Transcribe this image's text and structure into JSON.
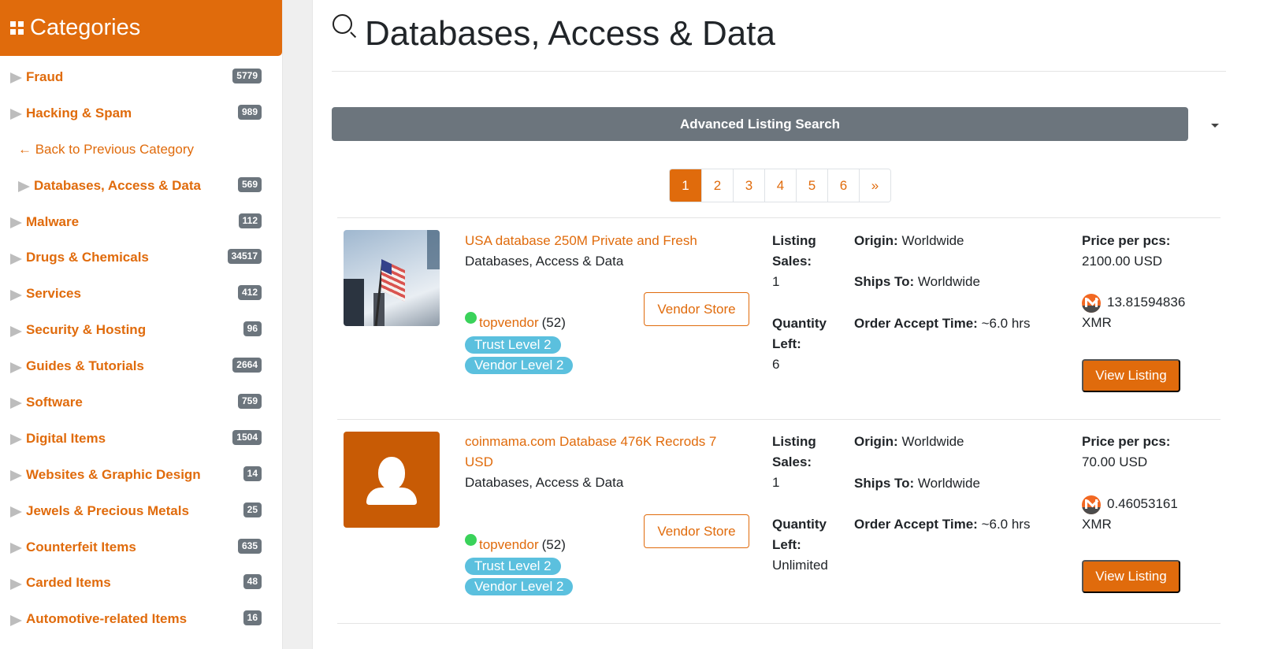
{
  "sidebar": {
    "header": "Categories",
    "back_label": "← Back to Previous Category",
    "categories": [
      {
        "label": "Fraud",
        "count": "5779"
      },
      {
        "label": "Hacking & Spam",
        "count": "989"
      },
      {
        "label": "Databases, Access & Data",
        "count": "569"
      },
      {
        "label": "Malware",
        "count": "112"
      },
      {
        "label": "Drugs & Chemicals",
        "count": "34517"
      },
      {
        "label": "Services",
        "count": "412"
      },
      {
        "label": "Security & Hosting",
        "count": "96"
      },
      {
        "label": "Guides & Tutorials",
        "count": "2664"
      },
      {
        "label": "Software",
        "count": "759"
      },
      {
        "label": "Digital Items",
        "count": "1504"
      },
      {
        "label": "Websites & Graphic Design",
        "count": "14"
      },
      {
        "label": "Jewels & Precious Metals",
        "count": "25"
      },
      {
        "label": "Counterfeit Items",
        "count": "635"
      },
      {
        "label": "Carded Items",
        "count": "48"
      },
      {
        "label": "Automotive-related Items",
        "count": "16"
      }
    ]
  },
  "main": {
    "title": "Databases, Access & Data",
    "advanced_search_label": "Advanced Listing Search",
    "pagination": {
      "pages": [
        "1",
        "2",
        "3",
        "4",
        "5",
        "6"
      ],
      "next": "»",
      "current": "1"
    },
    "labels": {
      "listing_sales": "Listing Sales:",
      "quantity_left": "Quantity Left:",
      "origin": "Origin:",
      "ships_to": "Ships To:",
      "order_accept_time": "Order Accept Time:",
      "price_per_pcs": "Price per pcs:",
      "vendor_store": "Vendor Store",
      "view_listing": "View Listing",
      "xmr": "XMR"
    },
    "listings": [
      {
        "title": "USA database 250M Private and Fresh",
        "category": "Databases, Access & Data",
        "vendor": "topvendor",
        "vendor_count": "(52)",
        "trust_level": "Trust Level 2",
        "vendor_level": "Vendor Level 2",
        "sales": "1",
        "quantity_left": "6",
        "origin": "Worldwide",
        "ships_to": "Worldwide",
        "order_accept_time": "~6.0 hrs",
        "price_usd": "2100.00 USD",
        "price_xmr": "13.81594836",
        "image": "usa-flag-photo"
      },
      {
        "title": "coinmama.com Database 476K Recrods 7 USD",
        "category": "Databases, Access & Data",
        "vendor": "topvendor",
        "vendor_count": "(52)",
        "trust_level": "Trust Level 2",
        "vendor_level": "Vendor Level 2",
        "sales": "1",
        "quantity_left": "Unlimited",
        "origin": "Worldwide",
        "ships_to": "Worldwide",
        "order_accept_time": "~6.0 hrs",
        "price_usd": "70.00 USD",
        "price_xmr": "0.46053161",
        "image": "placeholder-avatar"
      }
    ]
  },
  "colors": {
    "accent": "#e06b0c",
    "badge_gray": "#6c757d",
    "level_badge": "#5bc0de",
    "online": "#3ad25a"
  }
}
